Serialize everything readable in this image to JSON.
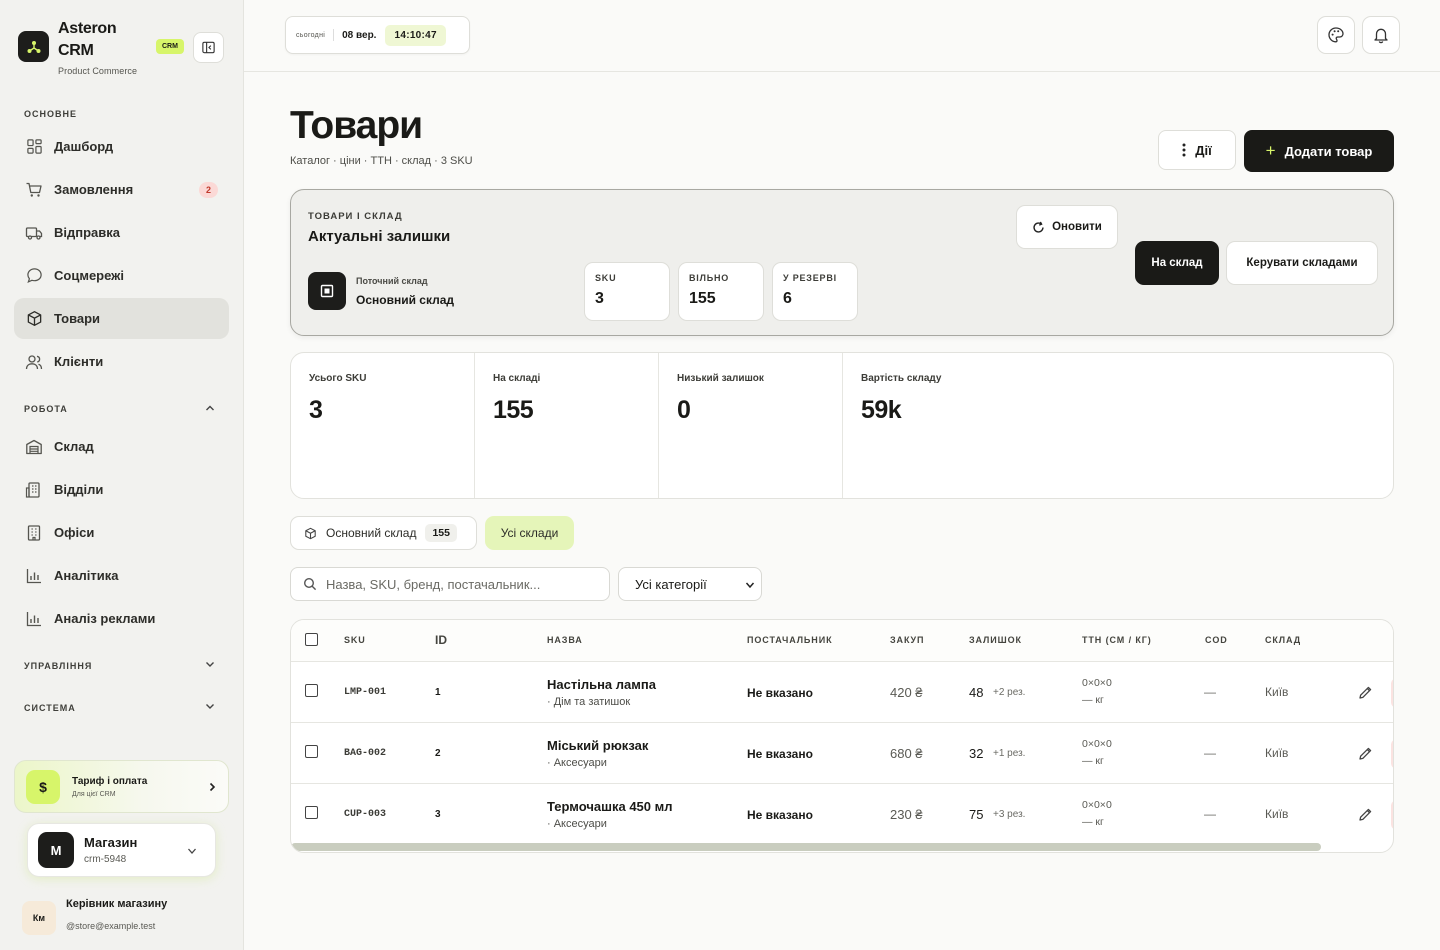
{
  "brand": {
    "name": "Asteron CRM",
    "subtitle": "Product Commerce",
    "badge": "CRM"
  },
  "sidebar": {
    "sections": {
      "main": "ОСНОВНЕ",
      "work": "РОБОТА",
      "management": "УПРАВЛІННЯ",
      "system": "СИСТЕМА"
    },
    "main_items": [
      {
        "label": "Дашборд",
        "icon": "dashboard-icon"
      },
      {
        "label": "Замовлення",
        "icon": "cart-icon",
        "badge": "2"
      },
      {
        "label": "Відправка",
        "icon": "truck-icon"
      },
      {
        "label": "Соцмережі",
        "icon": "chat-icon"
      },
      {
        "label": "Товари",
        "icon": "box-icon",
        "active": true
      },
      {
        "label": "Клієнти",
        "icon": "users-icon"
      }
    ],
    "work_items": [
      {
        "label": "Склад",
        "icon": "warehouse-icon"
      },
      {
        "label": "Відділи",
        "icon": "departments-icon"
      },
      {
        "label": "Офіси",
        "icon": "building-icon"
      },
      {
        "label": "Аналітика",
        "icon": "analytics-icon"
      },
      {
        "label": "Аналіз реклами",
        "icon": "ads-analytics-icon"
      }
    ],
    "tariff": {
      "icon_text": "$",
      "title": "Тариф і оплата",
      "subtitle": "Для цієї CRM"
    },
    "store": {
      "initial": "М",
      "title": "Магазин",
      "subtitle": "crm-5948"
    },
    "user": {
      "initials": "Км",
      "name": "Керівник магазину",
      "email": "@store@example.test"
    }
  },
  "topbar": {
    "today_label": "сьогодні",
    "date": "08 вер.",
    "time": "14:10:47"
  },
  "page": {
    "title": "Товари",
    "subtitle": "Каталог · ціни · ТТН · склад · 3 SKU",
    "actions_label": "Дії",
    "add_label": "Додати товар"
  },
  "stock_card": {
    "kicker": "ТОВАРИ І СКЛАД",
    "title": "Актуальні залишки",
    "current_wh_label": "Поточний склад",
    "current_wh_value": "Основний склад",
    "mini": [
      {
        "label": "SKU",
        "value": "3"
      },
      {
        "label": "ВІЛЬНО",
        "value": "155"
      },
      {
        "label": "У РЕЗЕРВІ",
        "value": "6"
      }
    ],
    "refresh_label": "Оновити",
    "to_stock_label": "На склад",
    "manage_label": "Керувати складами"
  },
  "stats": [
    {
      "label": "Усього SKU",
      "value": "3"
    },
    {
      "label": "На складі",
      "value": "155"
    },
    {
      "label": "Низький залишок",
      "value": "0"
    },
    {
      "label": "Вартість складу",
      "value": "59k"
    }
  ],
  "filters": {
    "main_wh_label": "Основний склад",
    "main_wh_count": "155",
    "all_wh_label": "Усі склади",
    "search_placeholder": "Назва, SKU, бренд, постачальник...",
    "category_selected": "Усі категорії"
  },
  "table": {
    "columns": [
      "SKU",
      "ID",
      "НАЗВА",
      "ПОСТАЧАЛЬНИК",
      "ЗАКУП",
      "ЗАЛИШОК",
      "ТТН (СМ / КГ)",
      "COD",
      "СКЛАД"
    ],
    "rows": [
      {
        "sku": "LMP-001",
        "id": "1",
        "name": "Настільна лампа",
        "category": "· Дім та затишок",
        "supplier": "Не вказано",
        "price": "420 ₴",
        "stock": "48",
        "reserve": "+2 рез.",
        "ttn_dims": "0×0×0",
        "ttn_weight": "— кг",
        "cod": "—",
        "warehouse": "Київ"
      },
      {
        "sku": "BAG-002",
        "id": "2",
        "name": "Міський рюкзак",
        "category": "· Аксесуари",
        "supplier": "Не вказано",
        "price": "680 ₴",
        "stock": "32",
        "reserve": "+1 рез.",
        "ttn_dims": "0×0×0",
        "ttn_weight": "— кг",
        "cod": "—",
        "warehouse": "Київ"
      },
      {
        "sku": "CUP-003",
        "id": "3",
        "name": "Термочашка 450 мл",
        "category": "· Аксесуари",
        "supplier": "Не вказано",
        "price": "230 ₴",
        "stock": "75",
        "reserve": "+3 рез.",
        "ttn_dims": "0×0×0",
        "ttn_weight": "— кг",
        "cod": "—",
        "warehouse": "Київ"
      }
    ]
  },
  "colors": {
    "accent": "#d7f56a",
    "dark": "#1a1a17",
    "badge_red": "#c0392b"
  }
}
